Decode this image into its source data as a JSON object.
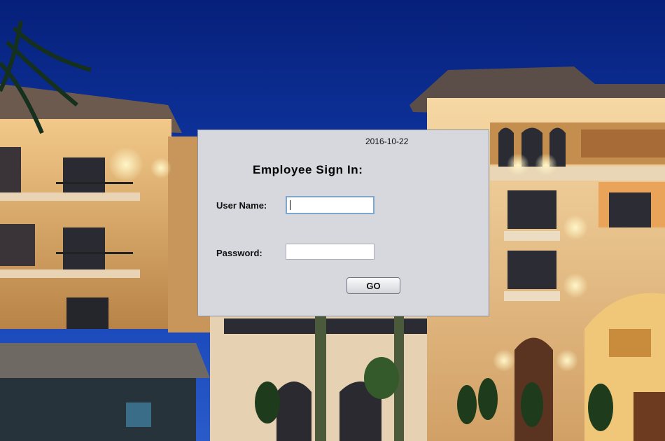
{
  "login": {
    "date": "2016-10-22",
    "title": "Employee Sign In:",
    "username_label": "User Name:",
    "username_value": "",
    "password_label": "Password:",
    "password_value": "",
    "go_label": "GO"
  },
  "colors": {
    "sky": "#0a2a8c",
    "panel": "#d7d8de",
    "building": "#d9a864"
  }
}
